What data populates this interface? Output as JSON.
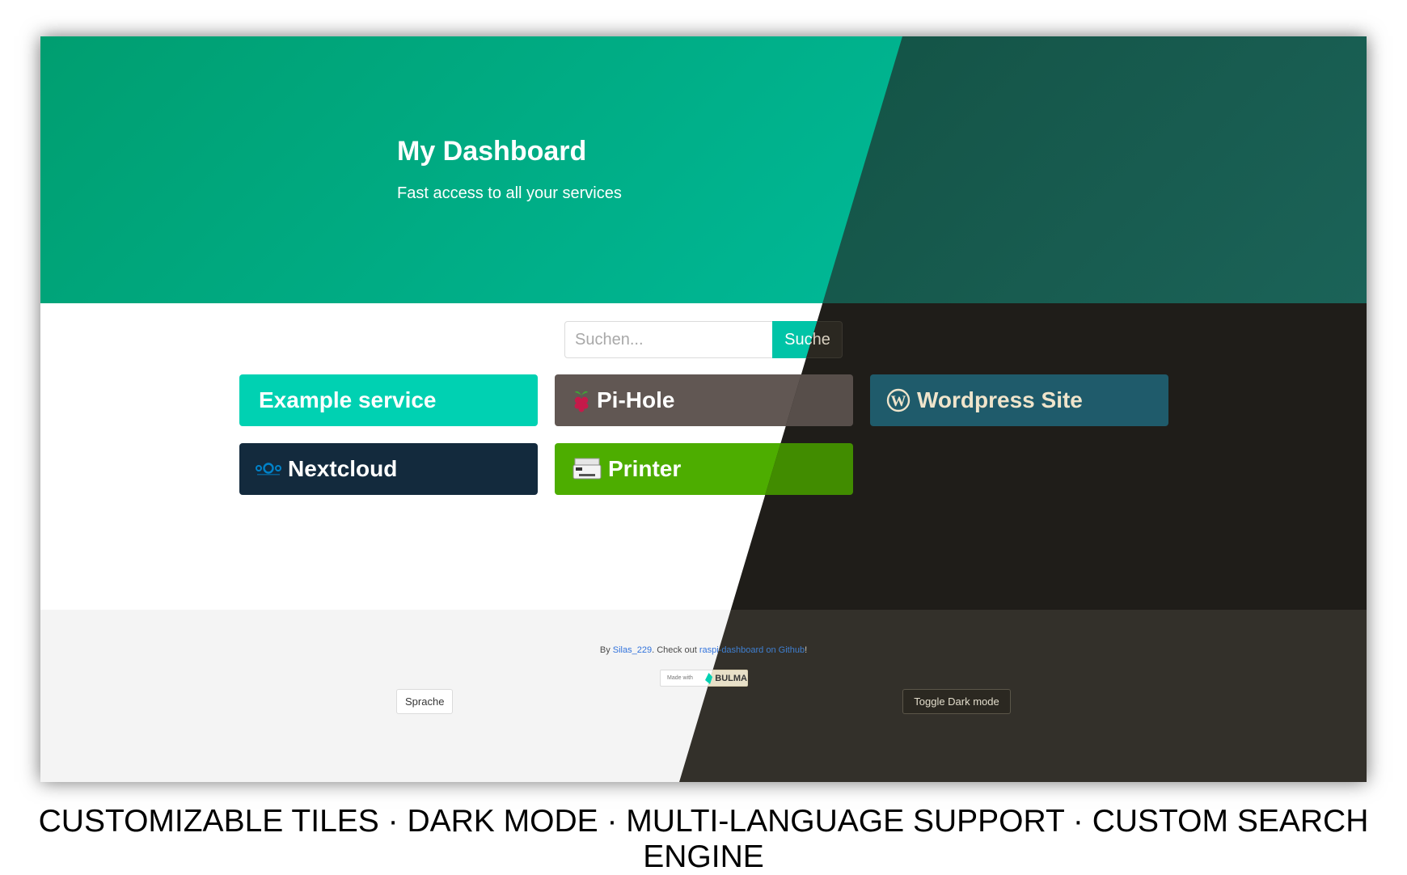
{
  "hero": {
    "title": "My Dashboard",
    "subtitle": "Fast access to all your services"
  },
  "search": {
    "placeholder": "Suchen...",
    "button_label": "Suche"
  },
  "tiles": [
    {
      "label": "Example service",
      "icon": null
    },
    {
      "label": "Pi-Hole",
      "icon": "raspberry-icon"
    },
    {
      "label": "Wordpress Site",
      "icon": "wordpress-icon"
    },
    {
      "label": "Nextcloud",
      "icon": "nextcloud-icon"
    },
    {
      "label": "Printer",
      "icon": "printer-icon"
    }
  ],
  "footer": {
    "credit_prefix": "By ",
    "author_link": "Silas_229",
    "credit_middle": ". Check out ",
    "repo_link": "raspi-dashboard on Github",
    "credit_suffix": "!",
    "badge_made_with": "Made with",
    "badge_name": "BULMA",
    "language_button": "Sprache",
    "dark_mode_button": "Toggle Dark mode"
  },
  "caption": "CUSTOMIZABLE TILES · DARK MODE · MULTI-LANGUAGE SUPPORT · CUSTOM SEARCH ENGINE",
  "colors": {
    "primary": "#00d1b2",
    "hero_light": "#00c4a7",
    "hero_dark": "#125042",
    "dark_background": "#1f1d19",
    "pihole_tile": "#615753",
    "wordpress_tile": "#1f5b6b",
    "nextcloud_tile": "#132a3d",
    "printer_tile": "#4dad00",
    "link": "#3273dc"
  }
}
